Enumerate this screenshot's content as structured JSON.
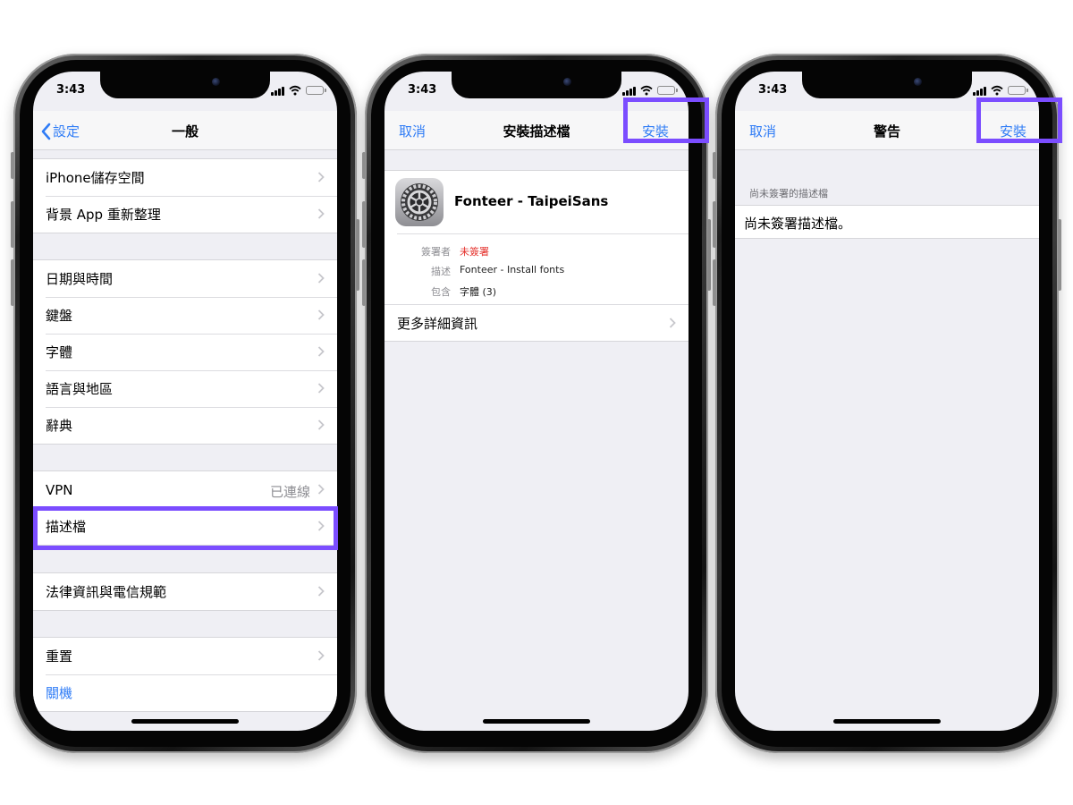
{
  "status_time": "3:43",
  "accent_color": "#2f7cf6",
  "highlight_color": "#7b4dff",
  "screen1": {
    "back_label": "設定",
    "title": "一般",
    "groups": [
      {
        "rows": [
          {
            "label": "iPhone儲存空間"
          },
          {
            "label": "背景 App 重新整理"
          }
        ]
      },
      {
        "rows": [
          {
            "label": "日期與時間"
          },
          {
            "label": "鍵盤"
          },
          {
            "label": "字體"
          },
          {
            "label": "語言與地區"
          },
          {
            "label": "辭典"
          }
        ]
      },
      {
        "rows": [
          {
            "label": "VPN",
            "value": "已連線"
          },
          {
            "label": "描述檔"
          }
        ]
      },
      {
        "rows": [
          {
            "label": "法律資訊與電信規範"
          }
        ]
      },
      {
        "rows": [
          {
            "label": "重置"
          },
          {
            "label": "關機"
          }
        ]
      }
    ]
  },
  "screen2": {
    "cancel_label": "取消",
    "title": "安裝描述檔",
    "install_label": "安裝",
    "profile_name": "Fonteer - TaipeiSans",
    "details": [
      {
        "key": "簽署者",
        "value": "未簽署"
      },
      {
        "key": "描述",
        "value": "Fonteer - Install fonts"
      },
      {
        "key": "包含",
        "value": "字體 (3)"
      }
    ],
    "more_label": "更多詳細資訊"
  },
  "screen3": {
    "cancel_label": "取消",
    "title": "警告",
    "install_label": "安裝",
    "section_header": "尚未簽署的描述檔",
    "message": "尚未簽署描述檔。"
  }
}
